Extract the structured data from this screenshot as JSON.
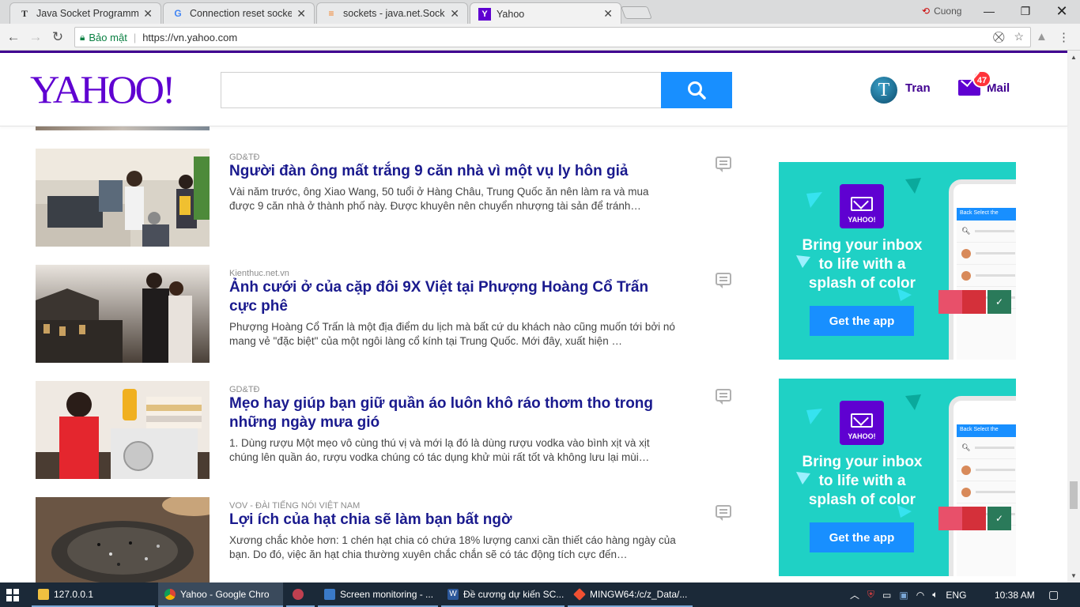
{
  "browser": {
    "tabs": [
      {
        "title": "Java Socket Programming",
        "favicon": "T"
      },
      {
        "title": "Connection reset socket",
        "favicon": "G"
      },
      {
        "title": "sockets - java.net.Socket",
        "favicon": "≡"
      },
      {
        "title": "Yahoo",
        "favicon": "Y"
      }
    ],
    "profile_name": "Cuong",
    "security_label": "Bảo mật",
    "url": "https://vn.yahoo.com"
  },
  "yahoo": {
    "logo": "YAHOO!",
    "user_initial": "T",
    "user_name": "Tran",
    "mail_count": "47",
    "mail_label": "Mail"
  },
  "articles": [
    {
      "source": "GD&TĐ",
      "title": "Người đàn ông mất trắng 9 căn nhà vì một vụ ly hôn giả",
      "desc": "Vài năm trước, ông Xiao Wang, 50 tuổi ở Hàng Châu, Trung Quốc ăn nên làm ra và mua được 9 căn nhà ở thành phố này. Được khuyên nên chuyển nhượng tài sản để tránh…"
    },
    {
      "source": "Kienthuc.net.vn",
      "title": "Ảnh cưới ở của cặp đôi 9X Việt tại Phượng Hoàng Cổ Trấn cực phê",
      "desc": "Phượng Hoàng Cổ Trấn là một địa điểm du lịch mà bất cứ du khách nào cũng muốn tới bởi nó mang vẻ \"đặc biệt\" của một ngôi làng cổ kính tại Trung Quốc. Mới đây, xuất hiện …"
    },
    {
      "source": "GD&TĐ",
      "title": "Mẹo hay giúp bạn giữ quần áo luôn khô ráo thơm tho trong những ngày mưa gió",
      "desc": "1. Dùng rượu Một mẹo vô cùng thú vị và mới lạ đó là dùng rượu vodka vào bình xịt và xịt chúng lên quần áo, rượu vodka chúng có tác dụng khử mùi rất tốt và không lưu lại mùi…"
    },
    {
      "source": "VOV - ĐÀI TIẾNG NÓI VIỆT NAM",
      "title": "Lợi ích của hạt chia sẽ làm bạn bất ngờ",
      "desc": "Xương chắc khỏe hơn: 1 chén hạt chia có chứa 18% lượng canxi cần thiết cáo hàng ngày của bạn. Do đó, việc ăn hạt chia thường xuyên chắc chắn sẽ có tác động tích cực đến…"
    }
  ],
  "ads": [
    {
      "logo_text": "YAHOO!",
      "headline": "Bring your inbox to life with a splash of color",
      "cta": "Get the app",
      "phone_header": "Back   Select the"
    },
    {
      "logo_text": "YAHOO!",
      "headline": "Bring your inbox to life with a splash of color",
      "cta": "Get the app",
      "phone_header": "Back   Select the"
    }
  ],
  "taskbar": {
    "items": [
      {
        "label": "127.0.0.1",
        "icon": "folder-icon"
      },
      {
        "label": "Yahoo - Google Chro",
        "icon": "chrome-icon"
      },
      {
        "label": "",
        "icon": "app-icon"
      },
      {
        "label": "Screen monitoring - ...",
        "icon": "virtualbox-icon"
      },
      {
        "label": "Đề cương dự kiến SC...",
        "icon": "word-icon"
      },
      {
        "label": "MINGW64:/c/z_Data/...",
        "icon": "git-icon"
      }
    ],
    "language": "ENG",
    "time": "10:38 AM"
  },
  "colors": {
    "yahoo_purple": "#400090",
    "search_blue": "#188fff",
    "ad_teal": "#1fd1c5"
  }
}
